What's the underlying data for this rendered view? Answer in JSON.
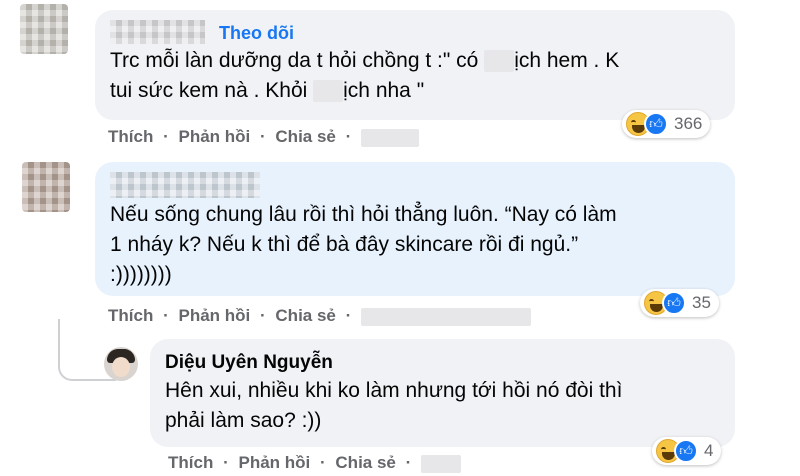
{
  "comments": [
    {
      "follow_label": "Theo dõi",
      "line1_a": "Trc mỗi làn dưỡng da t hỏi chồng t :\" có ",
      "line1_b": "ịch hem . K",
      "line2_a": "tui sức kem nà . Khỏi ",
      "line2_b": "ịch nha \"",
      "actions": {
        "like": "Thích",
        "reply": "Phản hồi",
        "share": "Chia sẻ",
        "sep": "·"
      },
      "reaction_count": "366"
    },
    {
      "line1": "Nếu sống chung lâu rồi thì hỏi thẳng luôn. “Nay có làm",
      "line2": "1 nháy k? Nếu k thì để bà đây skincare rồi đi ngủ.”",
      "line3": ":))))))))",
      "actions": {
        "like": "Thích",
        "reply": "Phản hồi",
        "share": "Chia sẻ",
        "sep": "·"
      },
      "reaction_count": "35"
    },
    {
      "author": "Diệu Uyên Nguyễn",
      "line1": "Hên xui, nhiều khi ko làm nhưng tới hồi nó đòi thì",
      "line2": "phải làm sao? :))",
      "actions": {
        "like": "Thích",
        "reply": "Phản hồi",
        "share": "Chia sẻ",
        "sep": "·"
      },
      "reaction_count": "4"
    }
  ],
  "colors": {
    "link": "#1877f2",
    "meta": "#65676b",
    "bubble": "#f0f2f5",
    "bubble_highlight": "#e8f2fd"
  },
  "icons": {
    "reaction_haha": "haha-icon",
    "reaction_like": "like-icon"
  }
}
